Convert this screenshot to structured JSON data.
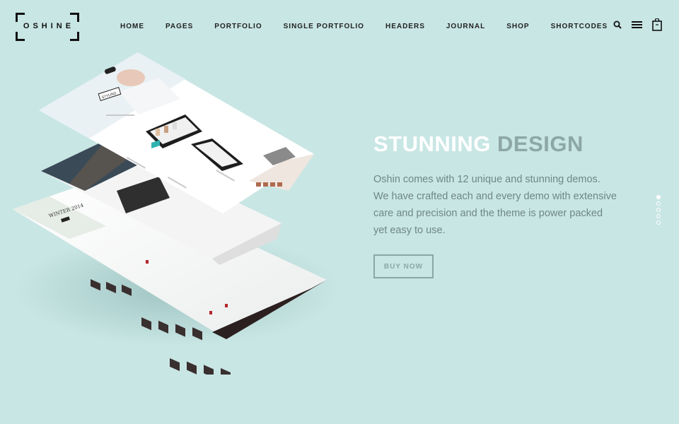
{
  "brand": {
    "name": "OSHINE"
  },
  "nav": {
    "items": [
      "HOME",
      "PAGES",
      "PORTFOLIO",
      "SINGLE PORTFOLIO",
      "HEADERS",
      "JOURNAL",
      "SHOP",
      "SHORTCODES"
    ]
  },
  "header_icons": [
    "search-icon",
    "menu-icon",
    "shopping-bag-icon"
  ],
  "hero": {
    "headline_part1": "STUNNING",
    "headline_part2": "DESIGN",
    "description": "Oshin comes with 12 unique and stunning demos. We have crafted each and every demo with extensive care and precision and the theme is power packed yet easy to use.",
    "button_label": "BUY NOW"
  },
  "mockup": {
    "banner_text": "WINTER 2014",
    "badge_text": "STYLING"
  },
  "pager": {
    "count": 5,
    "active_index": 0
  },
  "colors": {
    "background": "#c8e6e4",
    "headline_white": "#ffffff",
    "headline_muted": "#8ca7a5",
    "body_text": "#6f8785"
  }
}
